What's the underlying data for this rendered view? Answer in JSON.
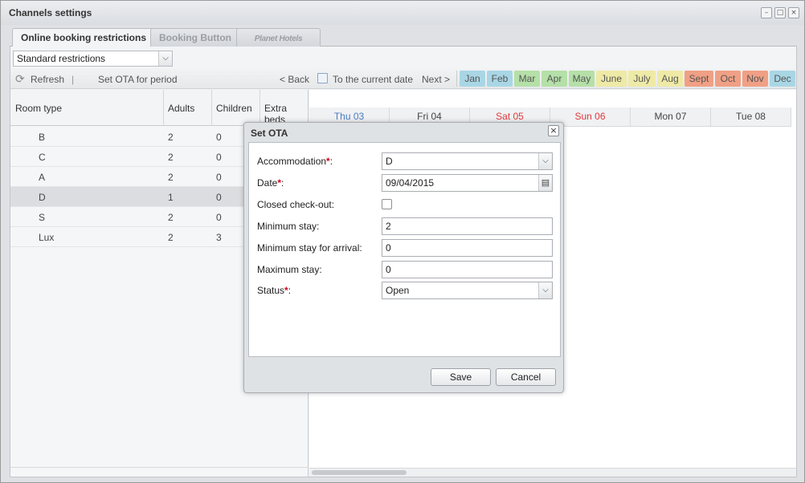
{
  "window": {
    "title": "Channels settings",
    "controls": [
      "–",
      "□",
      "×"
    ]
  },
  "tabs": [
    {
      "label": "Online booking restrictions",
      "active": true
    },
    {
      "label": "Booking Button",
      "active": false
    },
    {
      "label": "Planet Hotels",
      "active": false
    }
  ],
  "restriction_select": {
    "value": "Standard restrictions"
  },
  "toolbar": {
    "refresh_label": "Refresh",
    "separator": "|",
    "set_period_label": "Set OTA for period",
    "back_label": "< Back",
    "current_date_label": "To the current date",
    "next_label": "Next >"
  },
  "months": [
    {
      "label": "Jan",
      "color": "#a9d6e5"
    },
    {
      "label": "Feb",
      "color": "#a9d6e5"
    },
    {
      "label": "Mar",
      "color": "#b5e0a8"
    },
    {
      "label": "Apr",
      "color": "#b5e0a8"
    },
    {
      "label": "May",
      "color": "#b5e0a8"
    },
    {
      "label": "June",
      "color": "#eeeaa6"
    },
    {
      "label": "July",
      "color": "#eeeaa6"
    },
    {
      "label": "Aug",
      "color": "#eeeaa6"
    },
    {
      "label": "Sept",
      "color": "#f0a085"
    },
    {
      "label": "Oct",
      "color": "#f0a085"
    },
    {
      "label": "Nov",
      "color": "#f0a085"
    },
    {
      "label": "Dec",
      "color": "#a9d6e5"
    }
  ],
  "grid": {
    "columns": [
      "Room type",
      "Adults",
      "Children",
      "Extra beds"
    ],
    "rows": [
      {
        "room": "B",
        "adults": "2",
        "children": "0"
      },
      {
        "room": "C",
        "adults": "2",
        "children": "0"
      },
      {
        "room": "A",
        "adults": "2",
        "children": "0"
      },
      {
        "room": "D",
        "adults": "1",
        "children": "0"
      },
      {
        "room": "S",
        "adults": "2",
        "children": "0"
      },
      {
        "room": "Lux",
        "adults": "2",
        "children": "3"
      }
    ],
    "days": [
      {
        "label": "Thu 03",
        "color": "#4a7cc4"
      },
      {
        "label": "Fri 04",
        "color": "#444444"
      },
      {
        "label": "Sat 05",
        "color": "#e0393e"
      },
      {
        "label": "Sun 06",
        "color": "#e0393e"
      },
      {
        "label": "Mon 07",
        "color": "#444444"
      },
      {
        "label": "Tue 08",
        "color": "#444444"
      }
    ]
  },
  "modal": {
    "title": "Set OTA",
    "accommodation_label": "Accommodation",
    "accommodation_value": "D",
    "date_label": "Date",
    "date_value": "09/04/2015",
    "closed_checkout_label": "Closed check-out:",
    "min_stay_label": "Minimum stay:",
    "min_stay_value": "2",
    "min_stay_arrival_label": "Minimum stay for arrival:",
    "min_stay_arrival_value": "0",
    "max_stay_label": "Maximum stay:",
    "max_stay_value": "0",
    "status_label": "Status",
    "status_value": "Open",
    "required_mark": "*",
    "colon": ":",
    "save_label": "Save",
    "cancel_label": "Cancel"
  }
}
